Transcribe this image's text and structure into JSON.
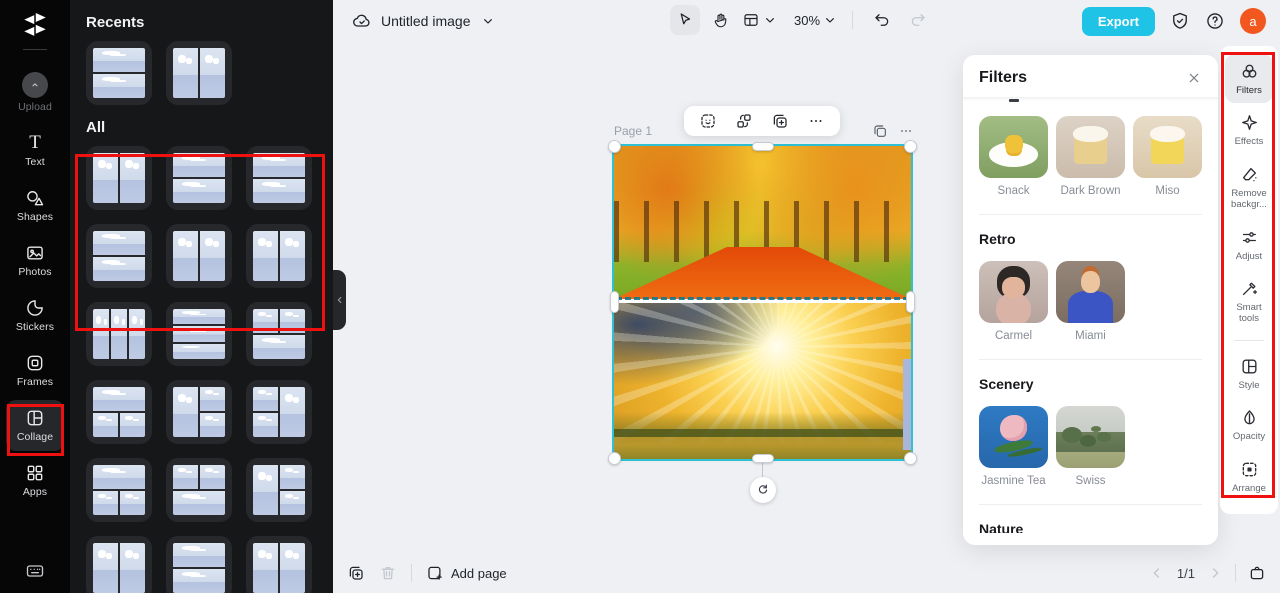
{
  "colors": {
    "accent": "#1ec3e6",
    "selection": "#2fc0d4",
    "annotation": "#ef1010",
    "avatar_bg": "#f2571f"
  },
  "topbar": {
    "doc_title": "Untitled image",
    "zoom_level": "30%",
    "export_label": "Export",
    "avatar_letter": "a"
  },
  "left_rail": {
    "items": [
      {
        "id": "upload",
        "label": "Upload",
        "icon": "upload-icon",
        "disabled": true,
        "selected": false
      },
      {
        "id": "text",
        "label": "Text",
        "icon": "text-icon",
        "disabled": false,
        "selected": false
      },
      {
        "id": "shapes",
        "label": "Shapes",
        "icon": "shapes-icon",
        "disabled": false,
        "selected": false
      },
      {
        "id": "photos",
        "label": "Photos",
        "icon": "photos-icon",
        "disabled": false,
        "selected": false
      },
      {
        "id": "stickers",
        "label": "Stickers",
        "icon": "stickers-icon",
        "disabled": false,
        "selected": false
      },
      {
        "id": "frames",
        "label": "Frames",
        "icon": "frames-icon",
        "disabled": false,
        "selected": false
      },
      {
        "id": "collage",
        "label": "Collage",
        "icon": "collage-icon",
        "disabled": false,
        "selected": true
      },
      {
        "id": "apps",
        "label": "Apps",
        "icon": "apps-icon",
        "disabled": false,
        "selected": false
      }
    ]
  },
  "templates_panel": {
    "sections": [
      {
        "title": "Recents",
        "layouts": [
          "rows-2",
          "cols-2"
        ]
      },
      {
        "title": "All",
        "layouts": [
          "cols-2",
          "rows-2",
          "rows-2",
          "rows-2",
          "cols-2",
          "cols-2",
          "cols-3",
          "rows-3",
          "top2-bottom1",
          "top1-bottom2",
          "left1-right2",
          "left2-right1",
          "top1-bottom2",
          "top2-bottom1",
          "left1-right2",
          "cols-2",
          "rows-2",
          "cols-2"
        ]
      }
    ]
  },
  "canvas": {
    "page_label": "Page 1"
  },
  "filters_panel": {
    "title": "Filters",
    "groups": [
      {
        "title": "",
        "items": [
          {
            "name": "Snack",
            "art": "snack"
          },
          {
            "name": "Dark Brown",
            "art": "darkbrown"
          },
          {
            "name": "Miso",
            "art": "miso"
          }
        ]
      },
      {
        "title": "Retro",
        "items": [
          {
            "name": "Carmel",
            "art": "carmel"
          },
          {
            "name": "Miami",
            "art": "miami"
          }
        ]
      },
      {
        "title": "Scenery",
        "items": [
          {
            "name": "Jasmine Tea",
            "art": "jasmine"
          },
          {
            "name": "Swiss",
            "art": "swiss"
          }
        ]
      },
      {
        "title": "Nature",
        "items": []
      }
    ]
  },
  "right_rail": {
    "items": [
      {
        "id": "filters",
        "label": "Filters",
        "icon": "filters-icon",
        "selected": true,
        "divider_before": false
      },
      {
        "id": "effects",
        "label": "Effects",
        "icon": "effects-icon",
        "selected": false,
        "divider_before": false
      },
      {
        "id": "remove-background",
        "label": "Remove backgr...",
        "icon": "remove-background-icon",
        "selected": false,
        "divider_before": false
      },
      {
        "id": "adjust",
        "label": "Adjust",
        "icon": "adjust-icon",
        "selected": false,
        "divider_before": false
      },
      {
        "id": "smart-tools",
        "label": "Smart tools",
        "icon": "smart-tools-icon",
        "selected": false,
        "divider_before": false
      },
      {
        "id": "style",
        "label": "Style",
        "icon": "style-icon",
        "selected": false,
        "divider_before": true
      },
      {
        "id": "opacity",
        "label": "Opacity",
        "icon": "opacity-icon",
        "selected": false,
        "divider_before": false
      },
      {
        "id": "arrange",
        "label": "Arrange",
        "icon": "arrange-icon",
        "selected": false,
        "divider_before": false
      }
    ]
  },
  "bottom_bar": {
    "add_page_label": "Add page",
    "pagination": "1/1"
  }
}
